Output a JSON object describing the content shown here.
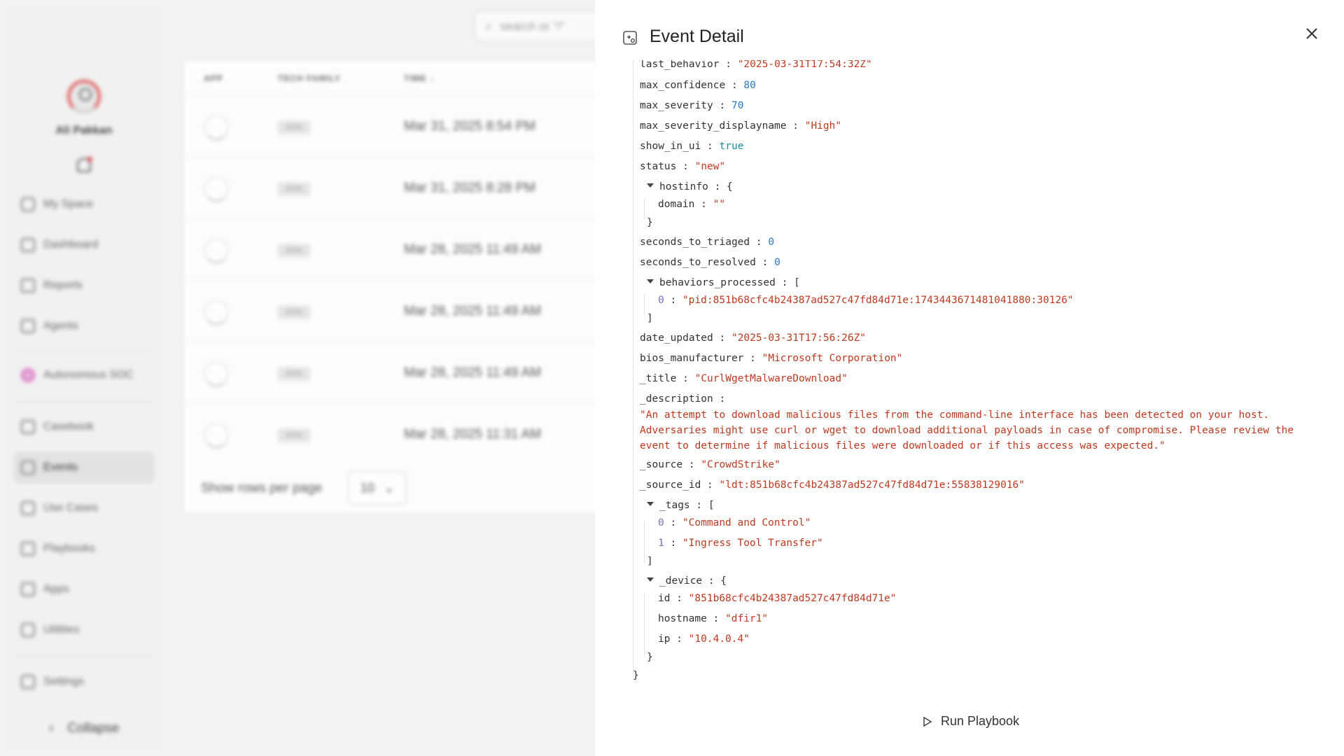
{
  "sidebar": {
    "user_name": "Ali Pakkan",
    "items": [
      {
        "label": "My Space",
        "icon": "home-icon"
      },
      {
        "label": "Dashboard",
        "icon": "grid-icon"
      },
      {
        "label": "Reports",
        "icon": "chart-icon"
      },
      {
        "label": "Agents",
        "icon": "agent-icon"
      },
      {
        "label": "Autonomous SOC",
        "icon": "eye-icon"
      },
      {
        "label": "Casebook",
        "icon": "hourglass-icon"
      },
      {
        "label": "Events",
        "icon": "clock-icon"
      },
      {
        "label": "Use Cases",
        "icon": "inbox-icon"
      },
      {
        "label": "Playbooks",
        "icon": "playbook-icon"
      },
      {
        "label": "Apps",
        "icon": "code-icon"
      },
      {
        "label": "Utilities",
        "icon": "wrench-icon"
      },
      {
        "label": "Settings",
        "icon": "gear-icon"
      }
    ],
    "collapse_label": "Collapse"
  },
  "main": {
    "search_placeholder": "search or \"/\"",
    "columns": [
      "APP",
      "TECH FAMILY",
      "TIME ↓"
    ],
    "rows": [
      {
        "tech": "EDR",
        "time": "Mar 31, 2025 8:54 PM"
      },
      {
        "tech": "EDR",
        "time": "Mar 31, 2025 8:28 PM"
      },
      {
        "tech": "EDR",
        "time": "Mar 28, 2025 11:49 AM"
      },
      {
        "tech": "EDR",
        "time": "Mar 28, 2025 11:49 AM"
      },
      {
        "tech": "EDR",
        "time": "Mar 28, 2025 11:49 AM"
      },
      {
        "tech": "EDR",
        "time": "Mar 28, 2025 11:31 AM"
      }
    ],
    "rows_per_page_label": "Show rows per page",
    "rows_per_page_value": "10"
  },
  "drawer": {
    "title": "Event Detail",
    "run_playbook_label": "Run Playbook",
    "json": {
      "last_behavior": "\"2025-03-31T17:54:32Z\"",
      "max_confidence": "80",
      "max_severity": "70",
      "max_severity_displayname": "\"High\"",
      "show_in_ui": "true",
      "status": "\"new\"",
      "hostinfo_key": "hostinfo",
      "hostinfo_domain": "\"\"",
      "seconds_to_triaged": "0",
      "seconds_to_resolved": "0",
      "behaviors_processed_key": "behaviors_processed",
      "behaviors_processed_0": "\"pid:851b68cfc4b24387ad527c47fd84d71e:1743443671481041880:30126\"",
      "date_updated": "\"2025-03-31T17:56:26Z\"",
      "bios_manufacturer": "\"Microsoft Corporation\"",
      "_title": "\"CurlWgetMalwareDownload\"",
      "_description": "\"An attempt to download malicious files from the command-line interface has been detected on your host. Adversaries might use curl or wget to download additional payloads in case of compromise. Please review the event to determine if malicious files were downloaded or if this access was expected.\"",
      "_source": "\"CrowdStrike\"",
      "_source_id": "\"ldt:851b68cfc4b24387ad527c47fd84d71e:55838129016\"",
      "_tags_0": "\"Command and Control\"",
      "_tags_1": "\"Ingress Tool Transfer\"",
      "_device_id": "\"851b68cfc4b24387ad527c47fd84d71e\"",
      "_device_hostname": "\"dfir1\"",
      "_device_ip": "\"10.4.0.4\""
    }
  }
}
